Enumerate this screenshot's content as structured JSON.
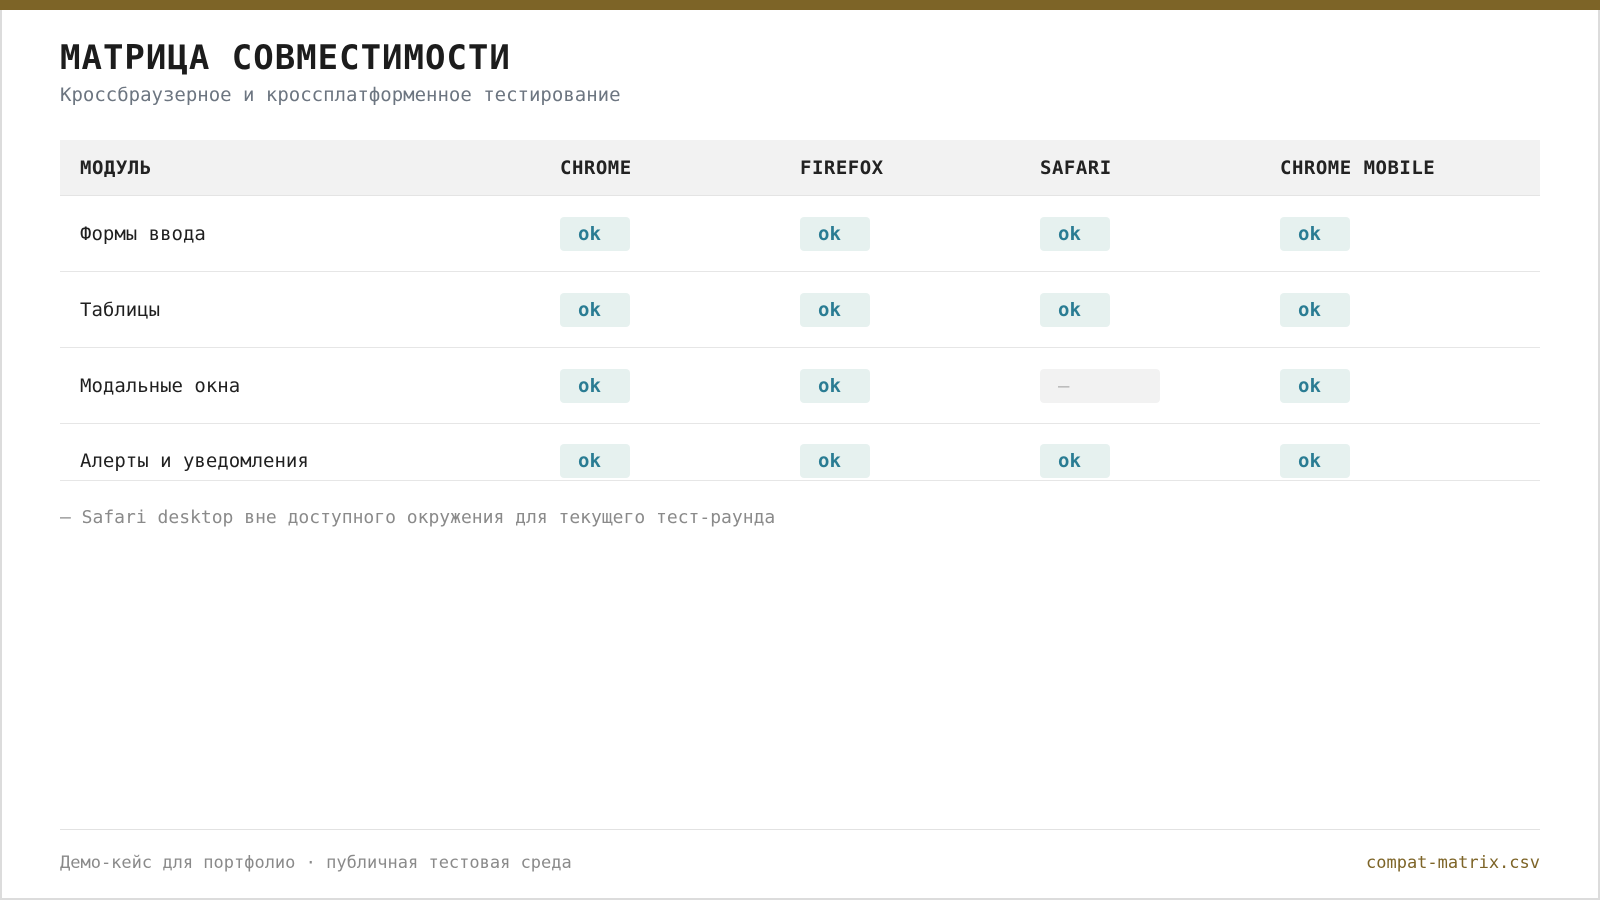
{
  "header": {
    "title": "МАТРИЦА СОВМЕСТИМОСТИ",
    "subtitle": "Кроссбраузерное и кроссплатформенное тестирование"
  },
  "matrix": {
    "columns": [
      "МОДУЛЬ",
      "CHROME",
      "FIREFOX",
      "SAFARI",
      "CHROME MOBILE"
    ],
    "rows": [
      {
        "module": "Формы ввода",
        "chrome": "ok",
        "firefox": "ok",
        "safari": "ok",
        "chrome_mobile": "ok"
      },
      {
        "module": "Таблицы",
        "chrome": "ok",
        "firefox": "ok",
        "safari": "ok",
        "chrome_mobile": "ok"
      },
      {
        "module": "Модальные окна",
        "chrome": "ok",
        "firefox": "ok",
        "safari": "—",
        "chrome_mobile": "ok"
      },
      {
        "module": "Алерты и уведомления",
        "chrome": "ok",
        "firefox": "ok",
        "safari": "ok",
        "chrome_mobile": "ok"
      }
    ]
  },
  "footnote": "— Safari desktop вне доступного окружения для текущего тест-раунда",
  "footer": {
    "left": "Демо-кейс для портфолио · публичная тестовая среда",
    "right": "compat-matrix.csv"
  },
  "colors": {
    "accent": "#7d6427",
    "ok_text": "#2a7c93",
    "ok_bg": "#e6f1ef"
  }
}
